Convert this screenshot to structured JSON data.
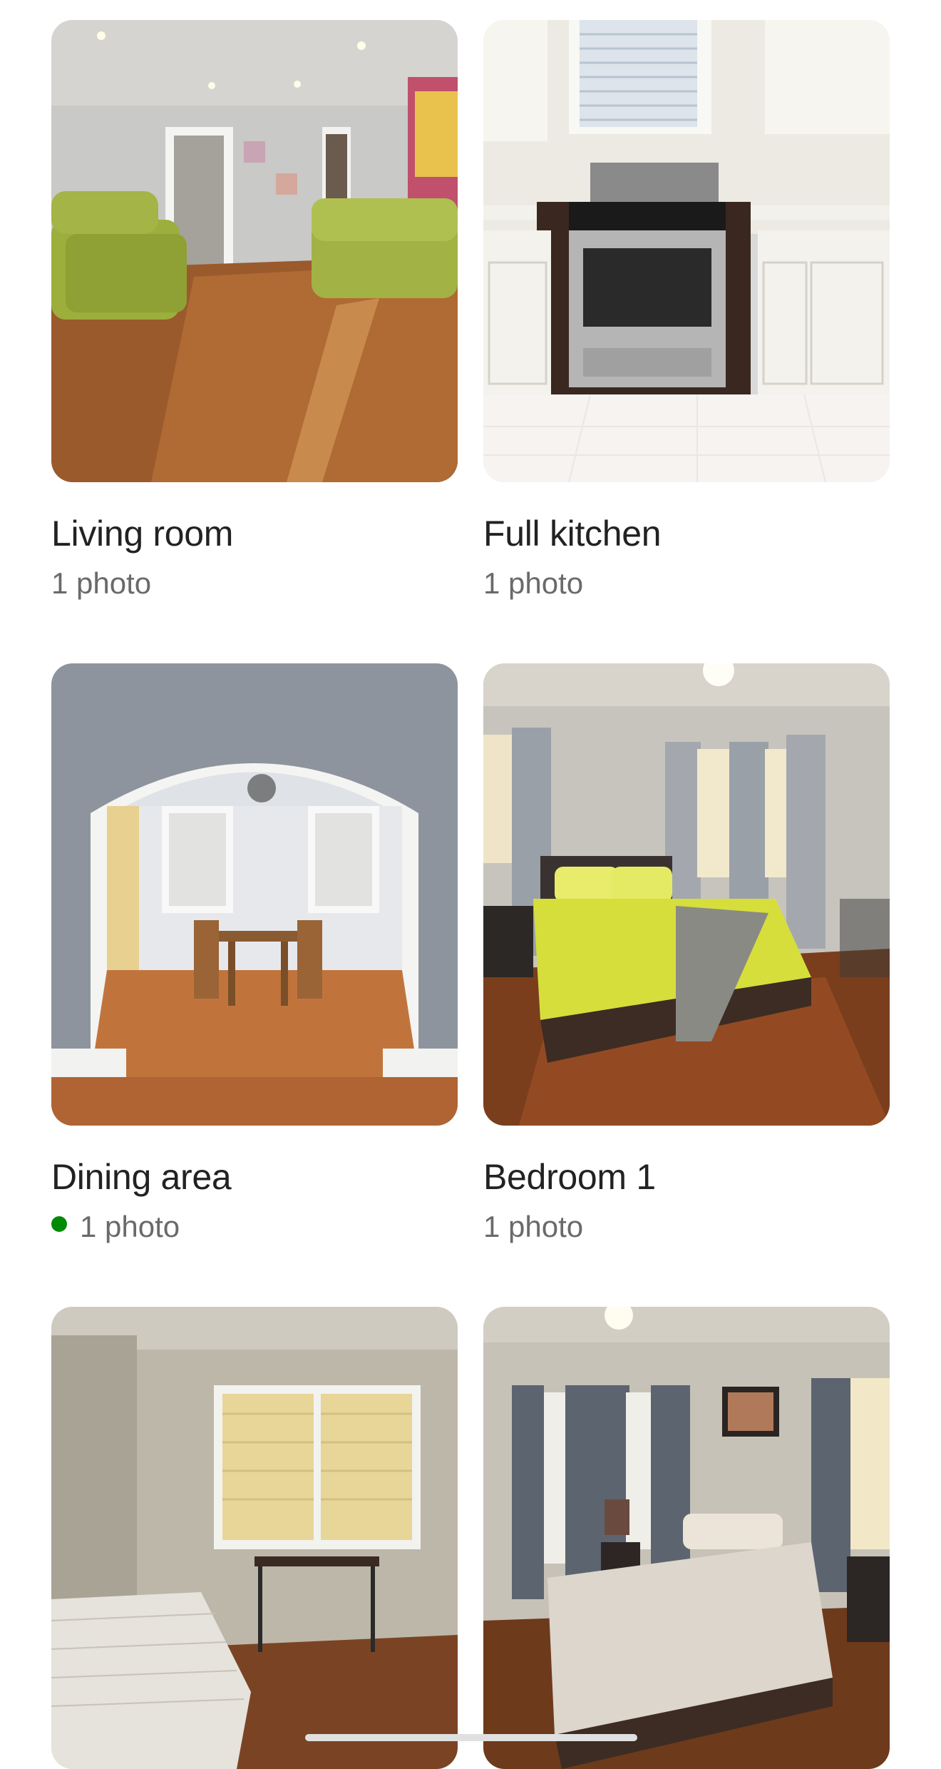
{
  "rooms": [
    {
      "title": "Living room",
      "subtitle": "1 photo",
      "photo": "living-room-photo",
      "new_indicator": false
    },
    {
      "title": "Full kitchen",
      "subtitle": "1 photo",
      "photo": "kitchen-photo",
      "new_indicator": false
    },
    {
      "title": "Dining area",
      "subtitle": "1 photo",
      "photo": "dining-area-photo",
      "new_indicator": true
    },
    {
      "title": "Bedroom 1",
      "subtitle": "1 photo",
      "photo": "bedroom-1-photo",
      "new_indicator": false
    },
    {
      "title": "",
      "subtitle": "",
      "photo": "bedroom-2-photo",
      "new_indicator": false
    },
    {
      "title": "",
      "subtitle": "",
      "photo": "bedroom-3-photo",
      "new_indicator": false
    }
  ],
  "colors": {
    "title": "#222222",
    "subtitle": "#6a6a6a",
    "indicator_dot": "#008a05"
  }
}
